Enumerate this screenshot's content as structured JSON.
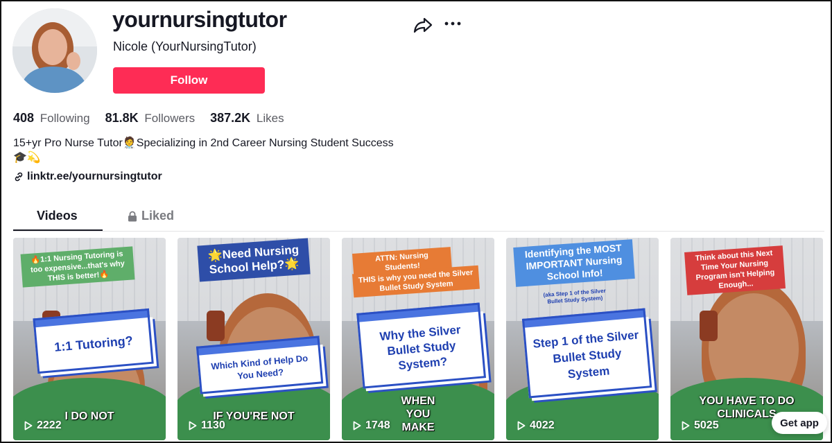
{
  "profile": {
    "username": "yournursingtutor",
    "nickname": "Nicole (YourNursingTutor)",
    "follow_label": "Follow",
    "stats": [
      {
        "value": "408",
        "label": "Following"
      },
      {
        "value": "81.8K",
        "label": "Followers"
      },
      {
        "value": "387.2K",
        "label": "Likes"
      }
    ],
    "bio": "15+yr Pro Nurse Tutor🧑‍⚕️Specializing in 2nd Career Nursing Student Success🎓💫",
    "link": "linktr.ee/yournursingtutor"
  },
  "tabs": {
    "videos": "Videos",
    "liked": "Liked"
  },
  "videos": [
    {
      "views": "2222",
      "top_caption": "🔥1:1 Nursing Tutoring is too expensive...that's why THIS is better!🔥",
      "window_text": "1:1 Tutoring?",
      "bottom_text": "I DO NOT"
    },
    {
      "views": "1130",
      "top_caption": "🌟Need Nursing School Help?🌟",
      "window_text": "Which Kind of Help Do You Need?",
      "bottom_text": "IF YOU'RE NOT"
    },
    {
      "views": "1748",
      "top_caption": "ATTN: Nursing Students!",
      "top_caption_2": "THIS is why you need the Silver Bullet Study System",
      "window_text": "Why the Silver Bullet Study System?",
      "bottom_text": "WHEN YOU MAKE"
    },
    {
      "views": "4022",
      "top_caption": "Identifying the MOST IMPORTANT Nursing School Info!",
      "small_caption": "(aka Step 1 of the Silver Bullet Study System)",
      "window_text": "Step 1 of the Silver Bullet Study System",
      "bottom_text": ""
    },
    {
      "views": "5025",
      "top_caption": "Think about this Next Time Your Nursing Program isn't Helping Enough...",
      "window_text": "",
      "bottom_text": "YOU HAVE TO DO CLINICALS"
    }
  ],
  "get_app_label": "Get app",
  "colors": {
    "follow": "#fe2c55",
    "window_border": "#2b50c4"
  }
}
